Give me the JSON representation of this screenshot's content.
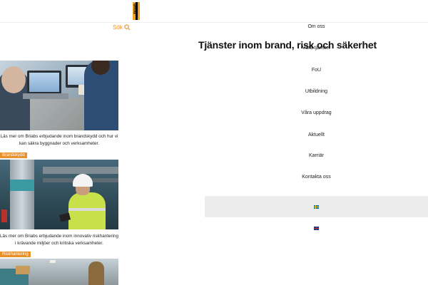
{
  "header": {
    "logo_text": "briab"
  },
  "search": {
    "label": "Sök"
  },
  "page": {
    "title": "Tjänster inom brand, risk och säkerhet"
  },
  "nav": {
    "items": [
      {
        "label": "Om oss"
      },
      {
        "label": "Våra tjänster"
      },
      {
        "label": "FoU"
      },
      {
        "label": "Utbildning"
      },
      {
        "label": "Våra uppdrag"
      },
      {
        "label": "Aktuellt"
      },
      {
        "label": "Karriär"
      },
      {
        "label": "Kontakta oss"
      }
    ],
    "languages": [
      {
        "code": "sv",
        "icon": "flag-sweden-icon",
        "active": true
      },
      {
        "code": "en",
        "icon": "flag-uk-icon",
        "active": false
      }
    ]
  },
  "cards": [
    {
      "text": "Läs mer om Briabs erbjudande inom brandskydd och hur vi kan säkra byggnader och verksamheter.",
      "tag": "Brandskydd"
    },
    {
      "text": "Läs mer om Briabs erbjudande inom innovativ riskhantering i krävande miljöer och kritiska verksamheter.",
      "tag": "Riskhantering"
    }
  ],
  "colors": {
    "accent": "#e8902a",
    "nav_active_bg": "#ececec",
    "title": "#111111"
  }
}
